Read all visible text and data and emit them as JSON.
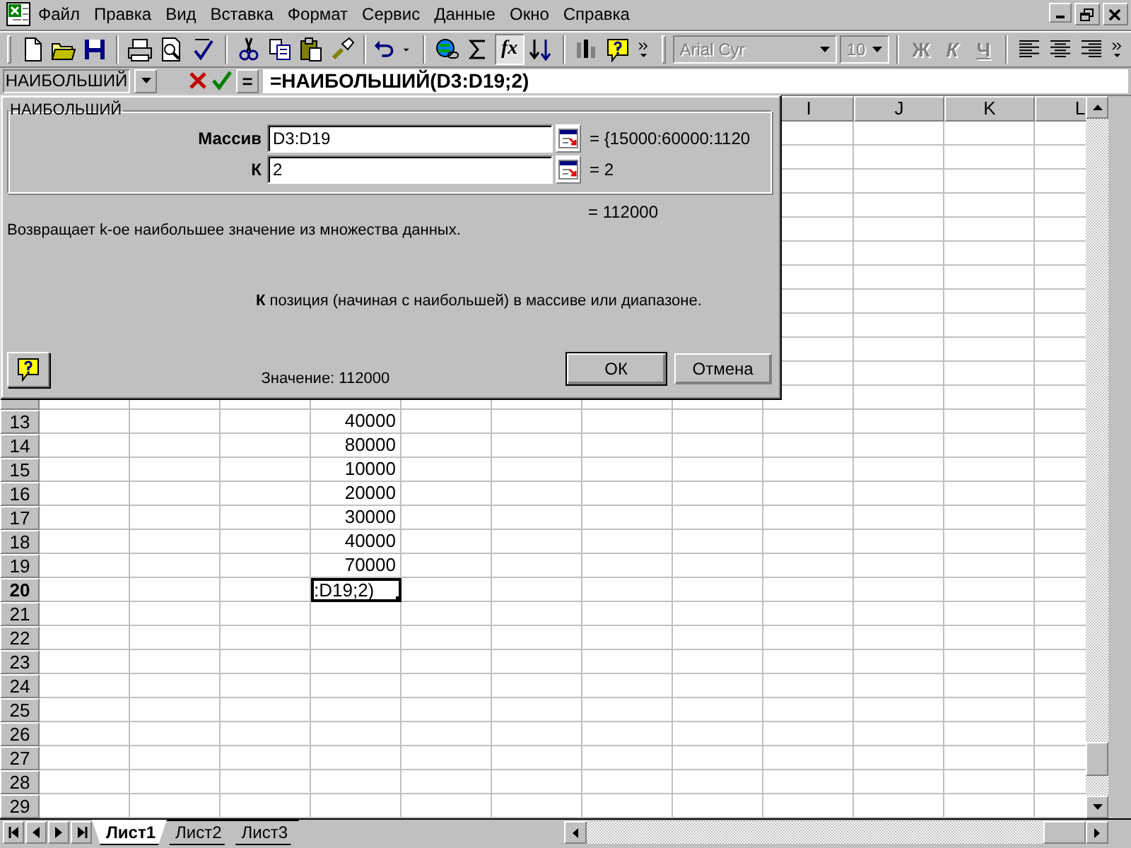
{
  "menu_bar": {
    "items": [
      "Файл",
      "Правка",
      "Вид",
      "Вставка",
      "Формат",
      "Сервис",
      "Данные",
      "Окно",
      "Справка"
    ]
  },
  "toolbar": {
    "function_button": "fx",
    "font_name": "Arial Cyr",
    "font_size": "10",
    "font_disabled": true,
    "format_buttons": [
      {
        "label": "Ж",
        "kind": "bold",
        "disabled": true
      },
      {
        "label": "К",
        "kind": "italic",
        "disabled": true
      },
      {
        "label": "Ч",
        "kind": "underline",
        "disabled": true
      }
    ]
  },
  "formula_bar": {
    "name_box": "НАИБОЛЬШИЙ",
    "equals_button": "=",
    "formula": "=НАИБОЛЬШИЙ(D3:D19;2)"
  },
  "dialog": {
    "group_title": "НАИБОЛЬШИЙ",
    "arguments": [
      {
        "label": "Массив",
        "value": "D3:D19",
        "result": "= {15000:60000:1120"
      },
      {
        "label": "К",
        "value": "2",
        "result": "= 2"
      }
    ],
    "formula_result": "= 112000",
    "description": "Возвращает k-ое наибольшее значение из множества данных.",
    "argument_help": "**К** позиция (начиная с наибольшей) в массиве или диапазоне.",
    "value_text": "Значение: 112000",
    "buttons": [
      {
        "label": "ОК",
        "kind": "default"
      },
      {
        "label": "Отмена",
        "kind": "normal"
      }
    ]
  },
  "sheet": {
    "columns": [
      "I",
      "J",
      "K",
      "L"
    ],
    "rows": [
      {
        "label": "13",
        "d": "40000",
        "selected": false
      },
      {
        "label": "14",
        "d": "80000",
        "selected": false
      },
      {
        "label": "15",
        "d": "10000",
        "selected": false
      },
      {
        "label": "16",
        "d": "20000",
        "selected": false
      },
      {
        "label": "17",
        "d": "30000",
        "selected": false
      },
      {
        "label": "18",
        "d": "40000",
        "selected": false
      },
      {
        "label": "19",
        "d": "70000",
        "selected": false
      },
      {
        "label": "20",
        "d": ":D19;2)",
        "selected": true
      },
      {
        "label": "21",
        "selected": false
      },
      {
        "label": "22",
        "selected": false
      },
      {
        "label": "23",
        "selected": false
      },
      {
        "label": "24",
        "selected": false
      },
      {
        "label": "25",
        "selected": false
      },
      {
        "label": "26",
        "selected": false
      },
      {
        "label": "27",
        "selected": false
      },
      {
        "label": "28",
        "selected": false
      },
      {
        "label": "29",
        "selected": false
      }
    ]
  },
  "sheet_tabs": [
    {
      "label": "Лист1",
      "selected": true
    },
    {
      "label": "Лист2",
      "selected": false
    },
    {
      "label": "Лист3",
      "selected": false
    }
  ]
}
